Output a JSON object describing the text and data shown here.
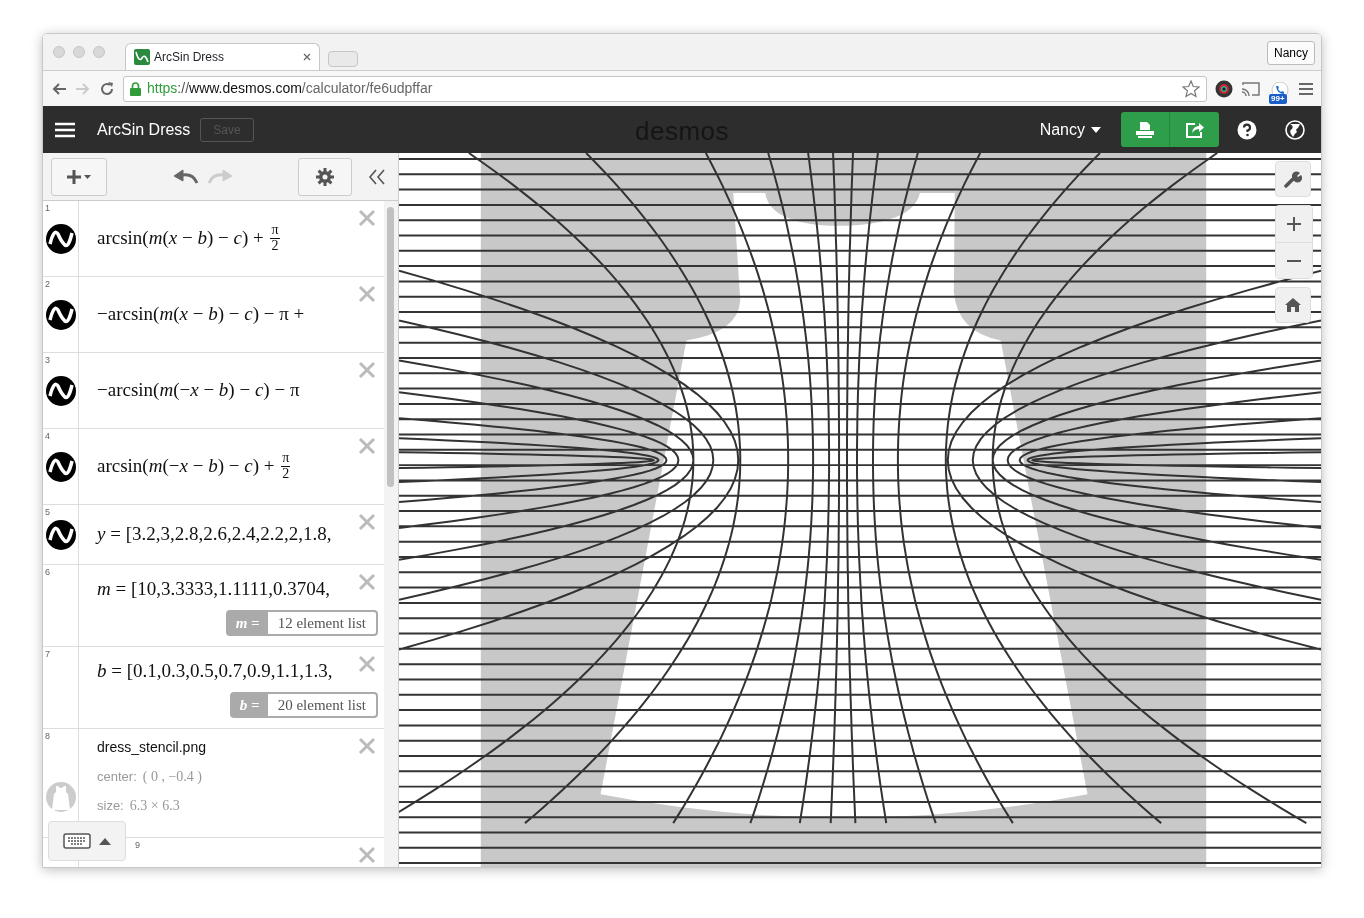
{
  "browser": {
    "tab": {
      "title": "ArcSin Dress"
    },
    "profile": "Nancy",
    "extension_badge": "99+",
    "url": [
      {
        "kind": "scheme",
        "text": "https"
      },
      {
        "kind": "sep",
        "text": "://"
      },
      {
        "kind": "host",
        "text": "www.desmos.com"
      },
      {
        "kind": "path",
        "text": "/calculator/fe6udpffar"
      }
    ]
  },
  "header": {
    "title": "ArcSin Dress",
    "save": {
      "label": "Save",
      "disabled": true
    },
    "logo": "desmos",
    "user": "Nancy"
  },
  "toolbar": {
    "undo": {
      "disabled": false
    },
    "redo": {
      "disabled": true
    }
  },
  "expressions": [
    {
      "number": "1",
      "kind": "graph",
      "parts": [
        {
          "text": "arcsin(*m*(*x* − *b*) − *c*) + "
        },
        {
          "num": "π",
          "den": "2"
        }
      ]
    },
    {
      "number": "2",
      "kind": "graph",
      "parts": [
        {
          "text": "−arcsin(*m*(*x* − *b*) − *c*) − π +"
        }
      ]
    },
    {
      "number": "3",
      "kind": "graph",
      "parts": [
        {
          "text": "−arcsin(*m*(−*x* − *b*) − *c*) − π"
        }
      ]
    },
    {
      "number": "4",
      "kind": "graph",
      "parts": [
        {
          "text": "arcsin(*m*(−*x* − *b*) − *c*) + "
        },
        {
          "num": "π",
          "den": "2"
        }
      ]
    },
    {
      "number": "5",
      "kind": "graph",
      "parts": [
        {
          "text": "*y* = [3.2,3,2.8,2.6,2.4,2.2,2,1.8,"
        }
      ]
    },
    {
      "number": "6",
      "kind": "list",
      "parts": [
        {
          "text": "*m* = [10,3.3333,1.1111,0.3704,"
        }
      ],
      "summary": {
        "var": "m =",
        "text": "12 element list"
      }
    },
    {
      "number": "7",
      "kind": "list",
      "parts": [
        {
          "text": "*b* = [0.1,0.3,0.5,0.7,0.9,1.1,1.3,"
        }
      ],
      "summary": {
        "var": "b =",
        "text": "20 element list"
      }
    },
    {
      "number": "8",
      "kind": "image",
      "name": "dress_stencil.png",
      "center_label": "center:",
      "center": "( 0 , −0.4 )",
      "size_label": "size:",
      "size": "6.3 × 6.3"
    },
    {
      "number": "9",
      "kind": "partial"
    }
  ]
}
